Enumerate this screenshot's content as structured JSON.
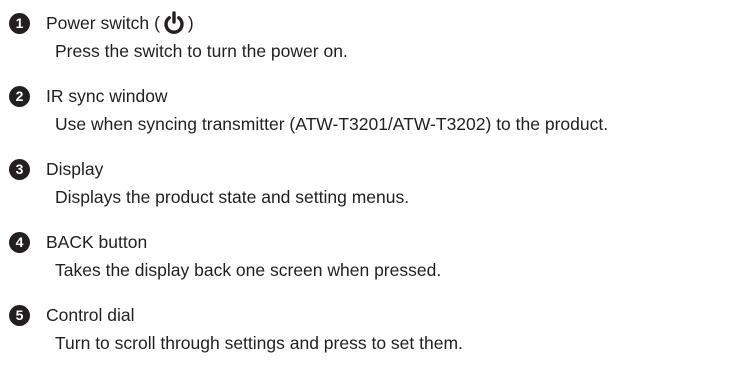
{
  "items": [
    {
      "number": "1",
      "title": "Power switch",
      "title_open": "(",
      "title_close": ")",
      "icon": "power-icon",
      "description": "Press the switch to turn the power on."
    },
    {
      "number": "2",
      "title": "IR sync window",
      "description": "Use when syncing transmitter (ATW-T3201/ATW-T3202) to the product."
    },
    {
      "number": "3",
      "title": "Display",
      "description": "Displays the product state and setting menus."
    },
    {
      "number": "4",
      "title": "BACK button",
      "description": "Takes the display back one screen when pressed."
    },
    {
      "number": "5",
      "title": "Control dial",
      "description": "Turn to scroll through settings and press to set them."
    }
  ]
}
